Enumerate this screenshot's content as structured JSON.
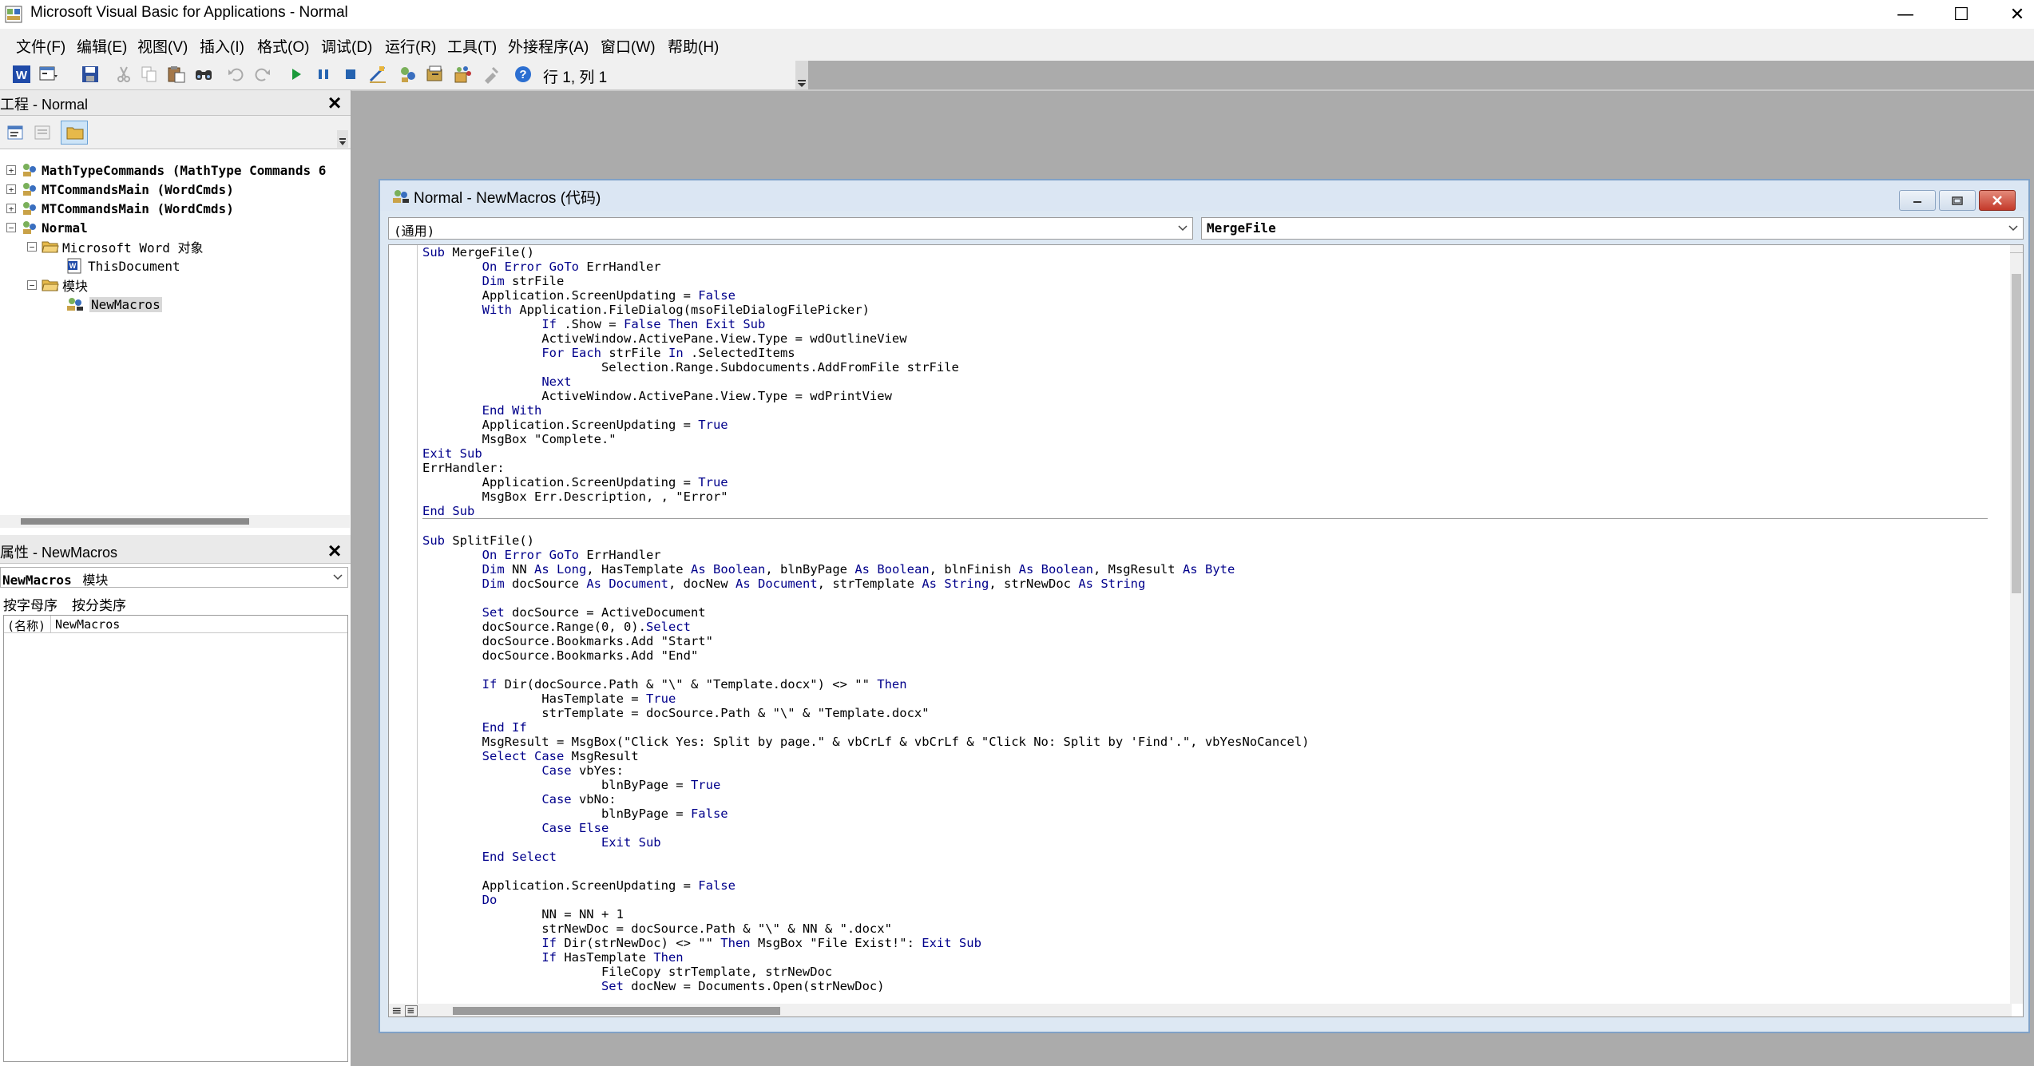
{
  "window": {
    "title": "Microsoft Visual Basic for Applications - Normal",
    "controls": {
      "minimize": "—",
      "maximize": "☐",
      "close": "✕"
    }
  },
  "menu": [
    "文件(F)",
    "编辑(E)",
    "视图(V)",
    "插入(I)",
    "格式(O)",
    "调试(D)",
    "运行(R)",
    "工具(T)",
    "外接程序(A)",
    "窗口(W)",
    "帮助(H)"
  ],
  "toolbar": {
    "position": "行 1, 列 1",
    "icons": [
      "word-icon",
      "insert-userform-icon",
      "save-icon",
      "cut-icon",
      "copy-icon",
      "paste-icon",
      "find-icon",
      "undo-icon",
      "redo-icon",
      "run-icon",
      "break-icon",
      "reset-icon",
      "design-mode-icon",
      "project-explorer-icon",
      "properties-window-icon",
      "object-browser-icon",
      "toolbox-icon",
      "help-icon"
    ]
  },
  "project_pane": {
    "title": "工程 - Normal",
    "tree": [
      {
        "label": "MathTypeCommands (MathType Commands 6",
        "bold": true,
        "level": 0,
        "expander": "+"
      },
      {
        "label": "MTCommandsMain (WordCmds)",
        "bold": true,
        "level": 0,
        "expander": "+"
      },
      {
        "label": "MTCommandsMain (WordCmds)",
        "bold": true,
        "level": 0,
        "expander": "+"
      },
      {
        "label": "Normal",
        "bold": true,
        "level": 0,
        "expander": "−"
      },
      {
        "label": "Microsoft Word 对象",
        "bold": false,
        "level": 1,
        "expander": "−"
      },
      {
        "label": "ThisDocument",
        "bold": false,
        "level": 2,
        "expander": ""
      },
      {
        "label": "模块",
        "bold": false,
        "level": 1,
        "expander": "−"
      },
      {
        "label": "NewMacros",
        "bold": false,
        "level": 2,
        "expander": ""
      }
    ]
  },
  "properties_pane": {
    "title": "属性 - NewMacros",
    "object_name": "NewMacros",
    "object_type": "模块",
    "tabs": [
      "按字母序",
      "按分类序"
    ],
    "rows": [
      {
        "name": "(名称)",
        "value": "NewMacros"
      }
    ]
  },
  "code_window": {
    "title": "Normal - NewMacros (代码)",
    "object_combo": "(通用)",
    "procedure_combo": "MergeFile",
    "lines": [
      "Sub MergeFile()",
      "        On Error GoTo ErrHandler",
      "        Dim strFile",
      "        Application.ScreenUpdating = False",
      "        With Application.FileDialog(msoFileDialogFilePicker)",
      "                If .Show = False Then Exit Sub",
      "                ActiveWindow.ActivePane.View.Type = wdOutlineView",
      "                For Each strFile In .SelectedItems",
      "                        Selection.Range.Subdocuments.AddFromFile strFile",
      "                Next",
      "                ActiveWindow.ActivePane.View.Type = wdPrintView",
      "        End With",
      "        Application.ScreenUpdating = True",
      "        MsgBox \"Complete.\"",
      "Exit Sub",
      "ErrHandler:",
      "        Application.ScreenUpdating = True",
      "        MsgBox Err.Description, , \"Error\"",
      "End Sub",
      "",
      "Sub SplitFile()",
      "        On Error GoTo ErrHandler",
      "        Dim NN As Long, HasTemplate As Boolean, blnByPage As Boolean, blnFinish As Boolean, MsgResult As Byte",
      "        Dim docSource As Document, docNew As Document, strTemplate As String, strNewDoc As String",
      "",
      "        Set docSource = ActiveDocument",
      "        docSource.Range(0, 0).Select",
      "        docSource.Bookmarks.Add \"Start\"",
      "        docSource.Bookmarks.Add \"End\"",
      "",
      "        If Dir(docSource.Path & \"\\\" & \"Template.docx\") <> \"\" Then",
      "                HasTemplate = True",
      "                strTemplate = docSource.Path & \"\\\" & \"Template.docx\"",
      "        End If",
      "        MsgResult = MsgBox(\"Click Yes: Split by page.\" & vbCrLf & vbCrLf & \"Click No: Split by 'Find'.\", vbYesNoCancel)",
      "        Select Case MsgResult",
      "                Case vbYes:",
      "                        blnByPage = True",
      "                Case vbNo:",
      "                        blnByPage = False",
      "                Case Else",
      "                        Exit Sub",
      "        End Select",
      "",
      "        Application.ScreenUpdating = False",
      "        Do",
      "                NN = NN + 1",
      "                strNewDoc = docSource.Path & \"\\\" & NN & \".docx\"",
      "                If Dir(strNewDoc) <> \"\" Then MsgBox \"File Exist!\": Exit Sub",
      "                If HasTemplate Then",
      "                        FileCopy strTemplate, strNewDoc",
      "                        Set docNew = Documents.Open(strNewDoc)"
    ],
    "separator_after_line": 18,
    "keywords": [
      "Sub",
      "End Sub",
      "Exit Sub",
      "On Error",
      "GoTo",
      "Dim",
      "As",
      "Long",
      "Boolean",
      "Byte",
      "Document",
      "String",
      "False",
      "True",
      "With",
      "End With",
      "If",
      "Then",
      "End If",
      "For",
      "Each",
      "In",
      "Next",
      "Set",
      "Select",
      "Case",
      "Else",
      "End Select",
      "Do",
      "Exit"
    ]
  }
}
